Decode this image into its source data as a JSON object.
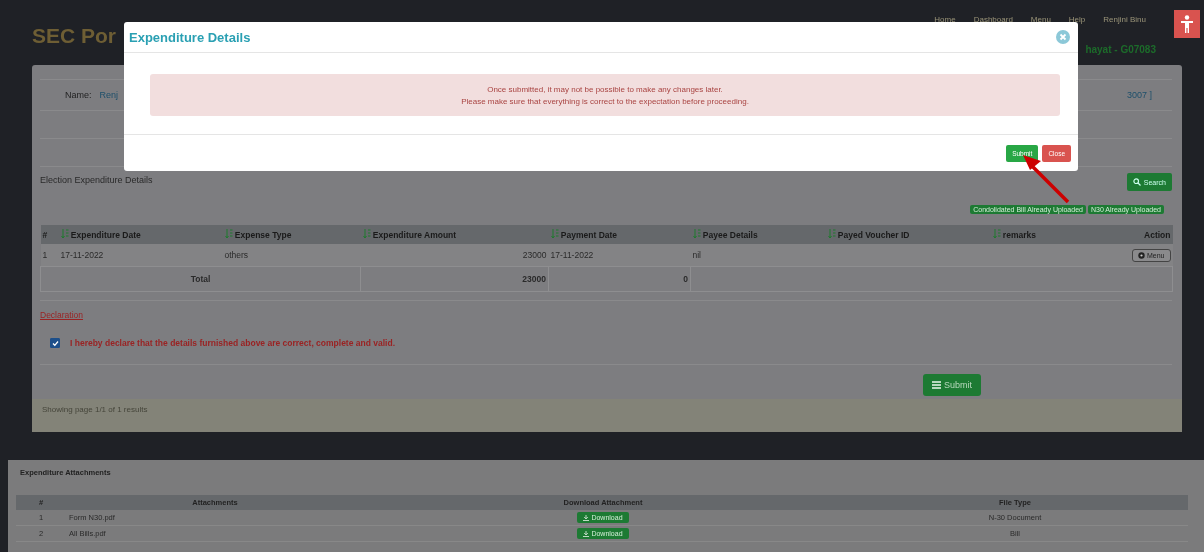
{
  "header": {
    "brand": "SEC Por",
    "nav": [
      {
        "label": "Home"
      },
      {
        "label": "Dashboard"
      },
      {
        "label": "Menu"
      },
      {
        "label": "Help"
      },
      {
        "label": "Renjini Binu"
      }
    ],
    "subtitle": "hayat - G07083"
  },
  "info": {
    "name_label": "Name:",
    "name_value": "Renj",
    "code": "3007 ]"
  },
  "section_title": "Election Expenditure Details",
  "search_button": "Search",
  "badges": [
    "Condolidated Bill Already Uploaded",
    "N30 Already Uploaded"
  ],
  "table": {
    "columns": [
      {
        "label": "#",
        "sortable": false
      },
      {
        "label": "Expenditure Date",
        "sortable": true
      },
      {
        "label": "Expense Type",
        "sortable": true
      },
      {
        "label": "Expenditure Amount",
        "sortable": true
      },
      {
        "label": "Payment Date",
        "sortable": true
      },
      {
        "label": "Payee Details",
        "sortable": true
      },
      {
        "label": "Payed Voucher ID",
        "sortable": true
      },
      {
        "label": "remarks",
        "sortable": true
      },
      {
        "label": "Action",
        "sortable": false
      }
    ],
    "rows": [
      {
        "num": "1",
        "date": "17-11-2022",
        "type": "others",
        "amount": "23000",
        "payment_date": "17-11-2022",
        "payee": "nil",
        "action": "Menu"
      }
    ],
    "total": {
      "label": "Total",
      "amount": "23000",
      "payment": "0"
    }
  },
  "declaration": {
    "title": "Declaration",
    "text": "I hereby declare that the details furnished above are correct, complete and valid.",
    "checked": true
  },
  "submit_button": "Submit",
  "pagination": "Showing page 1/1 of 1 results",
  "attachments": {
    "title": "Expenditure Attachments",
    "columns": [
      "#",
      "Attachments",
      "Download Attachment",
      "File Type"
    ],
    "rows": [
      {
        "num": "1",
        "file": "Form N30.pdf",
        "download": "Download",
        "type": "N-30 Document"
      },
      {
        "num": "2",
        "file": "All Bills.pdf",
        "download": "Download",
        "type": "Bill"
      }
    ]
  },
  "modal": {
    "title": "Expenditure Details",
    "message": [
      "Once submitted, it may not be possible to make any changes later.",
      "Please make sure that everything is correct to the expectation before proceeding."
    ],
    "buttons": [
      {
        "label": "Submit",
        "kind": "primary"
      },
      {
        "label": "Close",
        "kind": "danger"
      }
    ]
  }
}
